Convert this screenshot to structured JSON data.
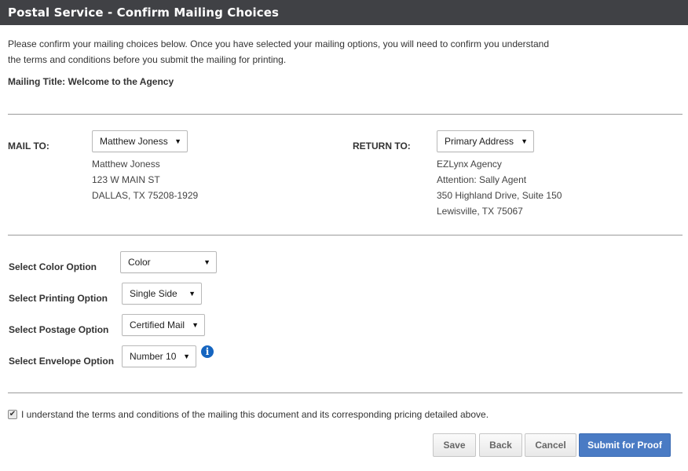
{
  "header": {
    "title": "Postal Service - Confirm Mailing Choices"
  },
  "intro": {
    "line1": "Please confirm your mailing choices below. Once you have selected your mailing options, you will need to confirm you understand",
    "line2": "the terms and conditions before you submit the mailing for printing."
  },
  "mailing_title": "Mailing Title: Welcome to the Agency",
  "mail_to": {
    "label": "MAIL TO:",
    "selected": "Matthew Joness",
    "address": [
      "Matthew Joness",
      "123 W MAIN ST",
      "DALLAS,  TX 75208-1929"
    ]
  },
  "return_to": {
    "label": "RETURN TO:",
    "selected": "Primary Address",
    "address": [
      "EZLynx Agency",
      "Attention: Sally Agent",
      "350 Highland Drive, Suite 150",
      "Lewisville, TX 75067"
    ]
  },
  "options": {
    "color": {
      "label": "Select Color Option",
      "selected": "Color"
    },
    "printing": {
      "label": "Select Printing Option",
      "selected": "Single Side"
    },
    "postage": {
      "label": "Select Postage Option",
      "selected": "Certified Mail"
    },
    "envelope": {
      "label": "Select Envelope Option",
      "selected": "Number 10"
    }
  },
  "icons": {
    "dropdown": "chevron-down-icon",
    "info": "info-icon",
    "check": "checkmark-icon"
  },
  "terms": {
    "checked": true,
    "label": "I understand the terms and conditions of the mailing this document and its corresponding pricing detailed above."
  },
  "buttons": {
    "save": "Save",
    "back": "Back",
    "cancel": "Cancel",
    "submit": "Submit for Proof"
  },
  "colors": {
    "header_bg": "#404145",
    "primary_button": "#4a7bc4",
    "info_icon": "#1565c0"
  }
}
